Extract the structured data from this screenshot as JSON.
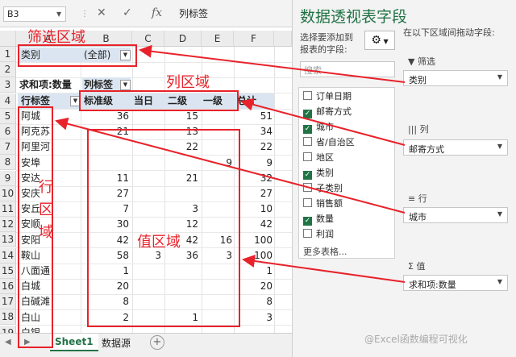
{
  "formula_bar": {
    "name_box": "B3",
    "formula": "列标签"
  },
  "columns": [
    "A",
    "B",
    "C",
    "D",
    "E",
    "F"
  ],
  "row_numbers": [
    "1",
    "2",
    "3",
    "4",
    "5",
    "6",
    "7",
    "8",
    "9",
    "10",
    "11",
    "12",
    "13",
    "14",
    "15",
    "16",
    "17",
    "18",
    "19"
  ],
  "pivot": {
    "filter_label": "类别",
    "filter_value": "(全部)",
    "value_label": "求和项:数量",
    "col_labels_header": "列标签",
    "row_labels_header": "行标签",
    "col_fields": [
      "标准级",
      "当日",
      "二级",
      "一级",
      "总计"
    ],
    "rows": [
      {
        "label": "阿城",
        "values": [
          "36",
          "",
          "15",
          "",
          "51"
        ]
      },
      {
        "label": "阿克苏",
        "values": [
          "21",
          "",
          "13",
          "",
          "34"
        ]
      },
      {
        "label": "阿里河",
        "values": [
          "",
          "",
          "22",
          "",
          "22"
        ]
      },
      {
        "label": "安埠",
        "values": [
          "",
          "",
          "",
          "9",
          "9"
        ]
      },
      {
        "label": "安达",
        "values": [
          "11",
          "",
          "21",
          "",
          "32"
        ]
      },
      {
        "label": "安庆",
        "values": [
          "27",
          "",
          "",
          "",
          "27"
        ]
      },
      {
        "label": "安丘",
        "values": [
          "7",
          "",
          "3",
          "",
          "10"
        ]
      },
      {
        "label": "安顺",
        "values": [
          "30",
          "",
          "12",
          "",
          "42"
        ]
      },
      {
        "label": "安阳",
        "values": [
          "42",
          "",
          "42",
          "16",
          "100"
        ]
      },
      {
        "label": "鞍山",
        "values": [
          "58",
          "3",
          "36",
          "3",
          "100"
        ]
      },
      {
        "label": "八面通",
        "values": [
          "1",
          "",
          "",
          "",
          "1"
        ]
      },
      {
        "label": "白城",
        "values": [
          "20",
          "",
          "",
          "",
          "20"
        ]
      },
      {
        "label": "白碱滩",
        "values": [
          "8",
          "",
          "",
          "",
          "8"
        ]
      },
      {
        "label": "白山",
        "values": [
          "2",
          "",
          "1",
          "",
          "3"
        ]
      },
      {
        "label": "白银",
        "values": [
          "",
          "",
          "",
          "",
          ""
        ]
      }
    ]
  },
  "sheet_tabs": [
    "Sheet1",
    "数据源"
  ],
  "add_sheet_icon": "+",
  "pane": {
    "title": "数据透视表字段",
    "choose_label_1": "选择要添加到",
    "choose_label_2": "报表的字段:",
    "drag_label": "在以下区域间拖动字段:",
    "search_placeholder": "搜索",
    "fields": [
      {
        "name": "订单日期",
        "checked": false
      },
      {
        "name": "邮寄方式",
        "checked": true
      },
      {
        "name": "城市",
        "checked": true
      },
      {
        "name": "省/自治区",
        "checked": false
      },
      {
        "name": "地区",
        "checked": false
      },
      {
        "name": "类别",
        "checked": true
      },
      {
        "name": "子类别",
        "checked": false
      },
      {
        "name": "销售额",
        "checked": false
      },
      {
        "name": "数量",
        "checked": true
      },
      {
        "name": "利润",
        "checked": false
      }
    ],
    "more_tables": "更多表格...",
    "areas": {
      "filter": {
        "label": "筛选",
        "icon": "▼",
        "value": "类别"
      },
      "columns": {
        "label": "列",
        "icon": "|||",
        "value": "邮寄方式"
      },
      "rows": {
        "label": "行",
        "icon": "≡",
        "value": "城市"
      },
      "values": {
        "label": "值",
        "icon": "Σ",
        "value": "求和项:数量"
      }
    }
  },
  "annotations": {
    "filter_area": "筛选区域",
    "column_area": "列区域",
    "row_area_chars": [
      "行",
      "区",
      "域"
    ],
    "value_area": "值区域"
  },
  "watermark": "@Excel函数编程可视化",
  "colors": {
    "excel_green": "#217346",
    "annotation_red": "#e8222a"
  }
}
